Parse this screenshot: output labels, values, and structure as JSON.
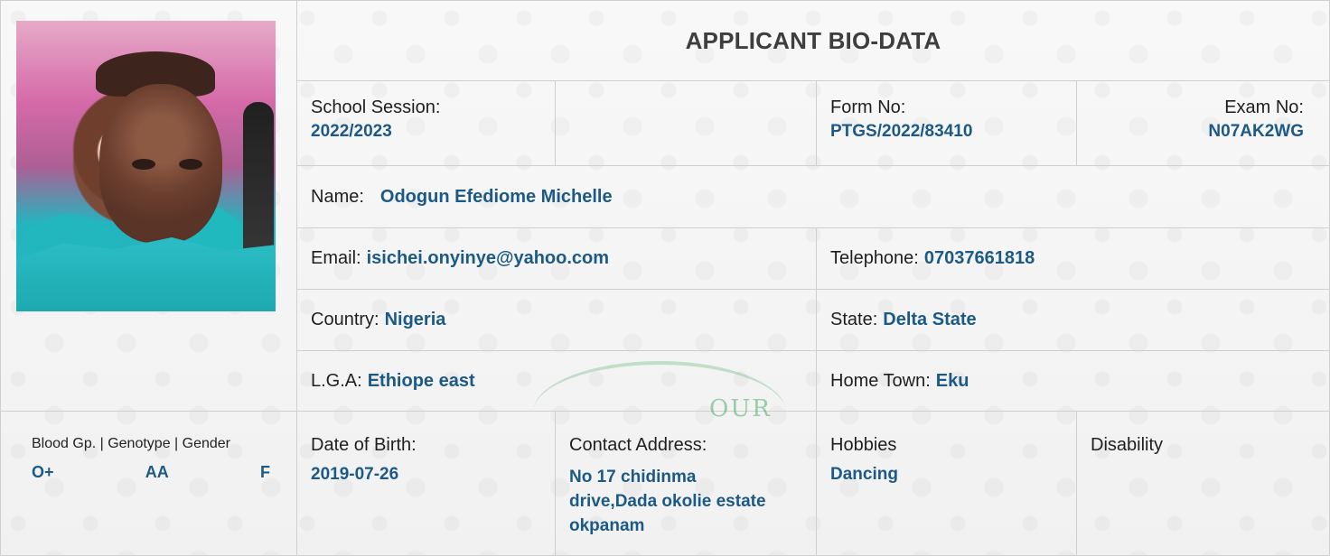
{
  "title": "APPLICANT BIO-DATA",
  "school_session": {
    "label": "School Session:",
    "value": "2022/2023"
  },
  "form_no": {
    "label": "Form No:",
    "value": "PTGS/2022/83410"
  },
  "exam_no": {
    "label": "Exam No:",
    "value": "N07AK2WG"
  },
  "name": {
    "label": "Name:",
    "value": "Odogun Efediome Michelle"
  },
  "email": {
    "label": "Email:",
    "value": "isichei.onyinye@yahoo.com"
  },
  "telephone": {
    "label": "Telephone:",
    "value": "07037661818"
  },
  "country": {
    "label": "Country:",
    "value": "Nigeria"
  },
  "state": {
    "label": "State:",
    "value": "Delta State"
  },
  "lga": {
    "label": "L.G.A:",
    "value": "Ethiope east"
  },
  "home_town": {
    "label": "Home Town:",
    "value": "Eku"
  },
  "bio": {
    "label": "Blood Gp. | Genotype | Gender",
    "blood_group": "O+",
    "genotype": "AA",
    "gender": "F"
  },
  "date_of_birth": {
    "label": "Date of Birth:",
    "value": "2019-07-26"
  },
  "contact_address": {
    "label": "Contact Address:",
    "value": "No 17 chidinma drive,Dada okolie estate okpanam"
  },
  "hobbies": {
    "label": "Hobbies",
    "value": "Dancing"
  },
  "disability": {
    "label": "Disability",
    "value": ""
  },
  "watermark": {
    "text": "OUR"
  },
  "colors": {
    "value_text": "#1c5a85",
    "border": "#cfcfcf",
    "title": "#3e3e3e",
    "watermark": "#4dad68"
  }
}
